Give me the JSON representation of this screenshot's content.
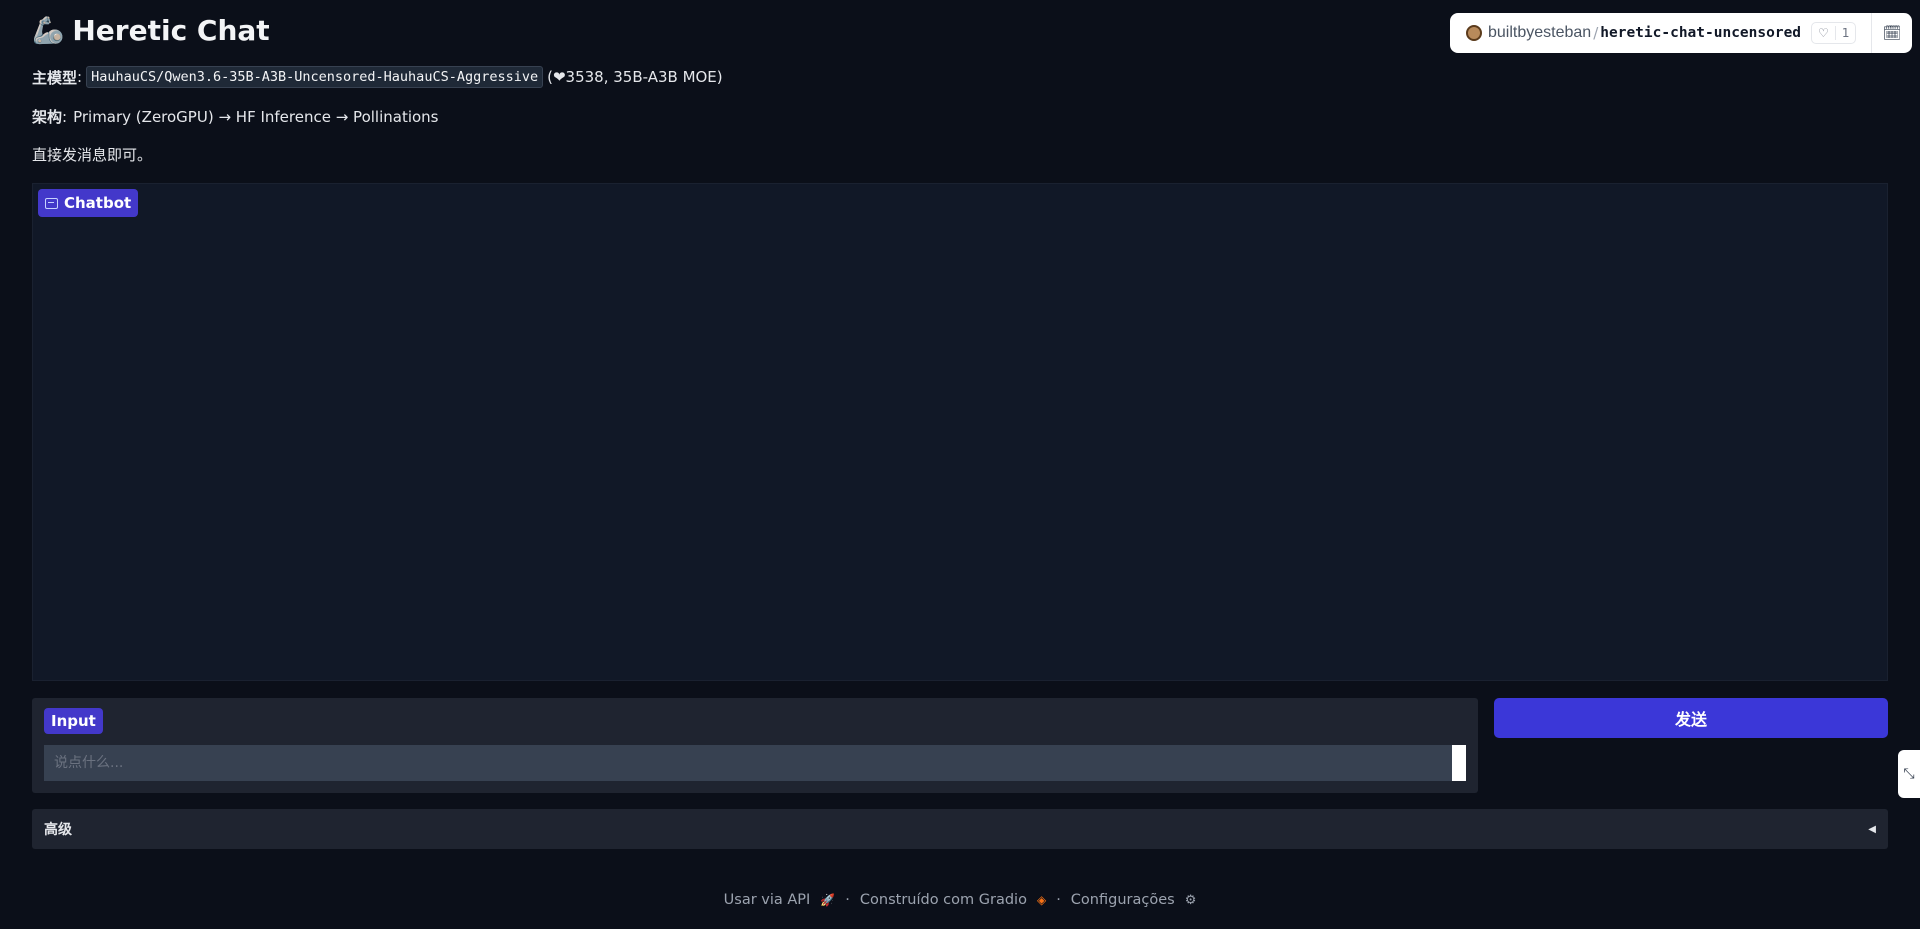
{
  "header": {
    "emoji": "🦾",
    "title": "Heretic Chat"
  },
  "info": {
    "model_label": "主模型",
    "model_sep": ":",
    "model_name": "HauhauCS/Qwen3.6-35B-A3B-Uncensored-HauhauCS-Aggressive",
    "model_meta": "(❤3538, 35B-A3B MOE)",
    "arch_label": "架构",
    "arch_sep": ":",
    "arch_value": "Primary (ZeroGPU) → HF Inference → Pollinations",
    "hint": "直接发消息即可。"
  },
  "hf_badge": {
    "owner": "builtbyesteban",
    "slash": "/",
    "repo": "heretic-chat-uncensored",
    "likes": "1"
  },
  "chatbot": {
    "label": "Chatbot"
  },
  "input": {
    "label": "Input",
    "placeholder": "说点什么...",
    "value": ""
  },
  "send": {
    "label": "发送"
  },
  "advanced": {
    "label": "高级",
    "arrow": "◀"
  },
  "footer": {
    "api": "Usar via API",
    "built": "Construído com Gradio",
    "settings": "Configurações",
    "separator": "·"
  },
  "colors": {
    "background": "#0b0f19",
    "accent": "#4338ca",
    "send_button": "#3b37d8"
  }
}
